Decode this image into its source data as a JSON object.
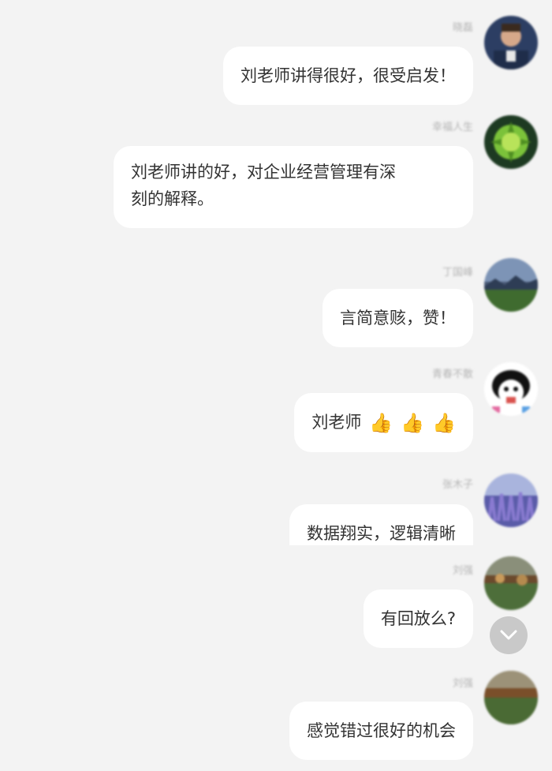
{
  "messages": [
    {
      "sender": "晓磊",
      "text": "刘老师讲得很好，很受启发！"
    },
    {
      "sender": "幸福人生",
      "text": "刘老师讲的好，对企业经营管理有深\n刻的解释。"
    },
    {
      "sender": "丁国峰",
      "text": "言简意赅，赞！"
    },
    {
      "sender": "青春不散",
      "text": "刘老师",
      "emoji": [
        "👍",
        "👍",
        "👍"
      ]
    },
    {
      "sender": "张木子",
      "text": "数据翔实，逻辑清晰"
    },
    {
      "sender": "刘强",
      "text": "有回放么?"
    },
    {
      "sender": "刘强",
      "text": "感觉错过很好的机会"
    }
  ],
  "icons": {
    "scroll_down": "chevron-down-icon"
  },
  "colors": {
    "background": "#f3f3f3",
    "bubble": "#ffffff",
    "text": "#333333",
    "scroll_button": "#c9c9c9"
  }
}
